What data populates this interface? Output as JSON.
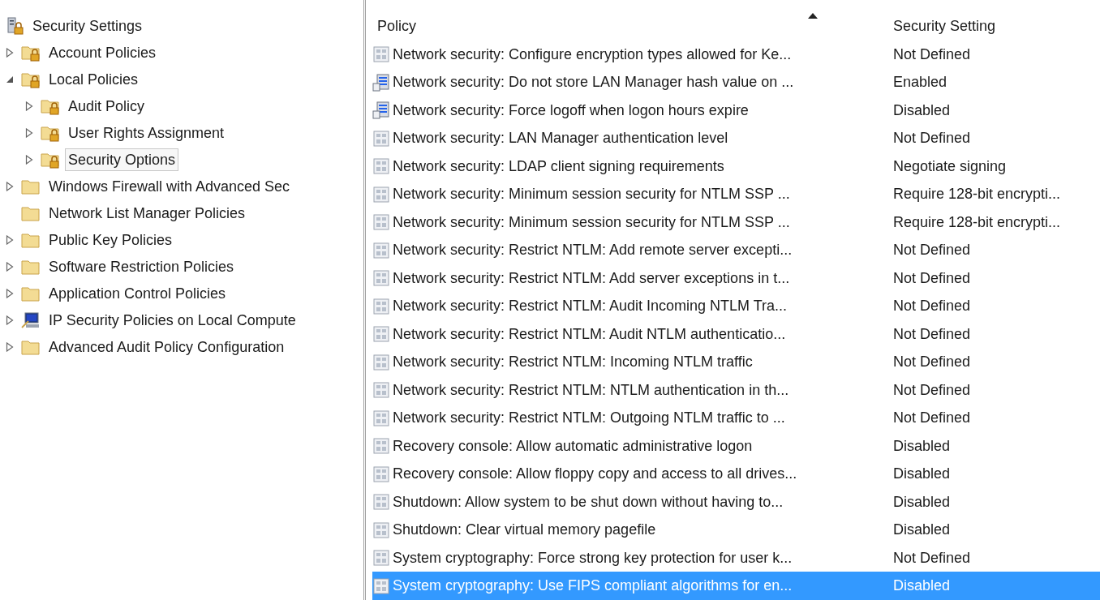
{
  "tree": [
    {
      "label": "Security Settings",
      "kind": "root",
      "selected": false,
      "children": [
        {
          "label": "Account Policies",
          "kind": "lock-folder",
          "expanded": false,
          "selected": false
        },
        {
          "label": "Local Policies",
          "kind": "lock-folder",
          "expanded": true,
          "selected": false,
          "children": [
            {
              "label": "Audit Policy",
              "kind": "lock-folder",
              "expanded": false,
              "selected": false
            },
            {
              "label": "User Rights Assignment",
              "kind": "lock-folder",
              "expanded": false,
              "selected": false
            },
            {
              "label": "Security Options",
              "kind": "lock-folder",
              "expanded": false,
              "selected": true
            }
          ]
        },
        {
          "label": "Windows Firewall with Advanced Sec",
          "kind": "folder",
          "expanded": false,
          "selected": false
        },
        {
          "label": "Network List Manager Policies",
          "kind": "folder",
          "selected": false
        },
        {
          "label": "Public Key Policies",
          "kind": "folder",
          "expanded": false,
          "selected": false
        },
        {
          "label": "Software Restriction Policies",
          "kind": "folder",
          "expanded": false,
          "selected": false
        },
        {
          "label": "Application Control Policies",
          "kind": "folder",
          "expanded": false,
          "selected": false
        },
        {
          "label": "IP Security Policies on Local Compute",
          "kind": "computer",
          "expanded": false,
          "selected": false
        },
        {
          "label": "Advanced Audit Policy Configuration",
          "kind": "folder",
          "expanded": false,
          "selected": false
        }
      ]
    }
  ],
  "table": {
    "columns": [
      "Policy",
      "Security Setting"
    ],
    "rows": [
      {
        "policy": "Network security: Configure encryption types allowed for Ke...",
        "setting": "Not Defined",
        "kind": "policy",
        "selected": false
      },
      {
        "policy": "Network security: Do not store LAN Manager hash value on ...",
        "setting": "Enabled",
        "kind": "registry",
        "selected": false
      },
      {
        "policy": "Network security: Force logoff when logon hours expire",
        "setting": "Disabled",
        "kind": "registry",
        "selected": false
      },
      {
        "policy": "Network security: LAN Manager authentication level",
        "setting": "Not Defined",
        "kind": "policy",
        "selected": false
      },
      {
        "policy": "Network security: LDAP client signing requirements",
        "setting": "Negotiate signing",
        "kind": "policy",
        "selected": false
      },
      {
        "policy": "Network security: Minimum session security for NTLM SSP ...",
        "setting": "Require 128-bit encrypti...",
        "kind": "policy",
        "selected": false
      },
      {
        "policy": "Network security: Minimum session security for NTLM SSP ...",
        "setting": "Require 128-bit encrypti...",
        "kind": "policy",
        "selected": false
      },
      {
        "policy": "Network security: Restrict NTLM: Add remote server excepti...",
        "setting": "Not Defined",
        "kind": "policy",
        "selected": false
      },
      {
        "policy": "Network security: Restrict NTLM: Add server exceptions in t...",
        "setting": "Not Defined",
        "kind": "policy",
        "selected": false
      },
      {
        "policy": "Network security: Restrict NTLM: Audit Incoming NTLM Tra...",
        "setting": "Not Defined",
        "kind": "policy",
        "selected": false
      },
      {
        "policy": "Network security: Restrict NTLM: Audit NTLM authenticatio...",
        "setting": "Not Defined",
        "kind": "policy",
        "selected": false
      },
      {
        "policy": "Network security: Restrict NTLM: Incoming NTLM traffic",
        "setting": "Not Defined",
        "kind": "policy",
        "selected": false
      },
      {
        "policy": "Network security: Restrict NTLM: NTLM authentication in th...",
        "setting": "Not Defined",
        "kind": "policy",
        "selected": false
      },
      {
        "policy": "Network security: Restrict NTLM: Outgoing NTLM traffic to ...",
        "setting": "Not Defined",
        "kind": "policy",
        "selected": false
      },
      {
        "policy": "Recovery console: Allow automatic administrative logon",
        "setting": "Disabled",
        "kind": "policy",
        "selected": false
      },
      {
        "policy": "Recovery console: Allow floppy copy and access to all drives...",
        "setting": "Disabled",
        "kind": "policy",
        "selected": false
      },
      {
        "policy": "Shutdown: Allow system to be shut down without having to...",
        "setting": "Disabled",
        "kind": "policy",
        "selected": false
      },
      {
        "policy": "Shutdown: Clear virtual memory pagefile",
        "setting": "Disabled",
        "kind": "policy",
        "selected": false
      },
      {
        "policy": "System cryptography: Force strong key protection for user k...",
        "setting": "Not Defined",
        "kind": "policy",
        "selected": false
      },
      {
        "policy": "System cryptography: Use FIPS compliant algorithms for en...",
        "setting": "Disabled",
        "kind": "policy",
        "selected": true
      }
    ]
  }
}
